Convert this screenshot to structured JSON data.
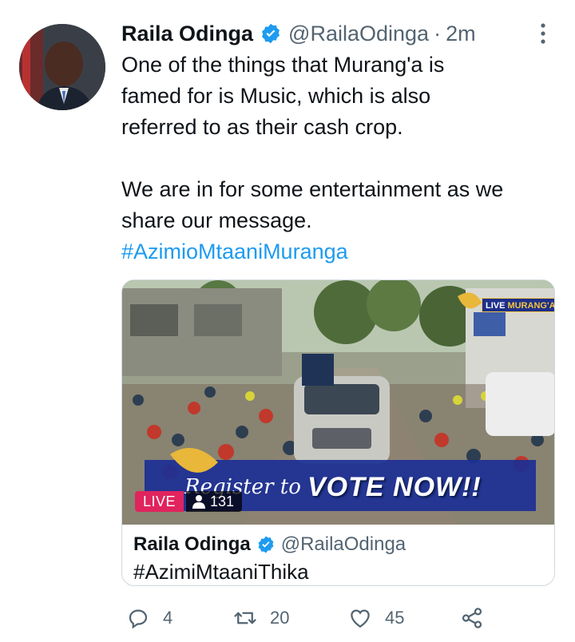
{
  "tweet": {
    "author_name": "Raila Odinga",
    "author_handle": "@RailaOdinga",
    "separator": "·",
    "timestamp": "2m",
    "text_lines": [
      "One of the things that Murang'a is",
      "famed for is Music, which is also",
      "referred to as their cash crop.",
      "",
      "We are in for some entertainment as we",
      "share our message."
    ],
    "hashtag": "#AzimioMtaaniMuranga"
  },
  "quote": {
    "author_name": "Raila Odinga",
    "author_handle": "@RailaOdinga",
    "text": "#AzimiMtaaniThika",
    "video": {
      "live_label": "LIVE",
      "viewer_count": "131",
      "banner_script": "Register to",
      "banner_text": "VOTE NOW!!",
      "channel_live": "LIVE",
      "channel_location": "MURANG'A"
    }
  },
  "actions": {
    "replies": "4",
    "retweets": "20",
    "likes": "45"
  },
  "colors": {
    "accent": "#1d9bf0",
    "text": "#0f1419",
    "muted": "#536471",
    "live": "#e0245e",
    "border": "#cfd9de"
  },
  "icons": {
    "verified": "verified-badge-icon",
    "more": "more-options-icon",
    "reply": "reply-icon",
    "retweet": "retweet-icon",
    "like": "heart-icon",
    "share": "share-icon",
    "viewers": "person-icon"
  }
}
